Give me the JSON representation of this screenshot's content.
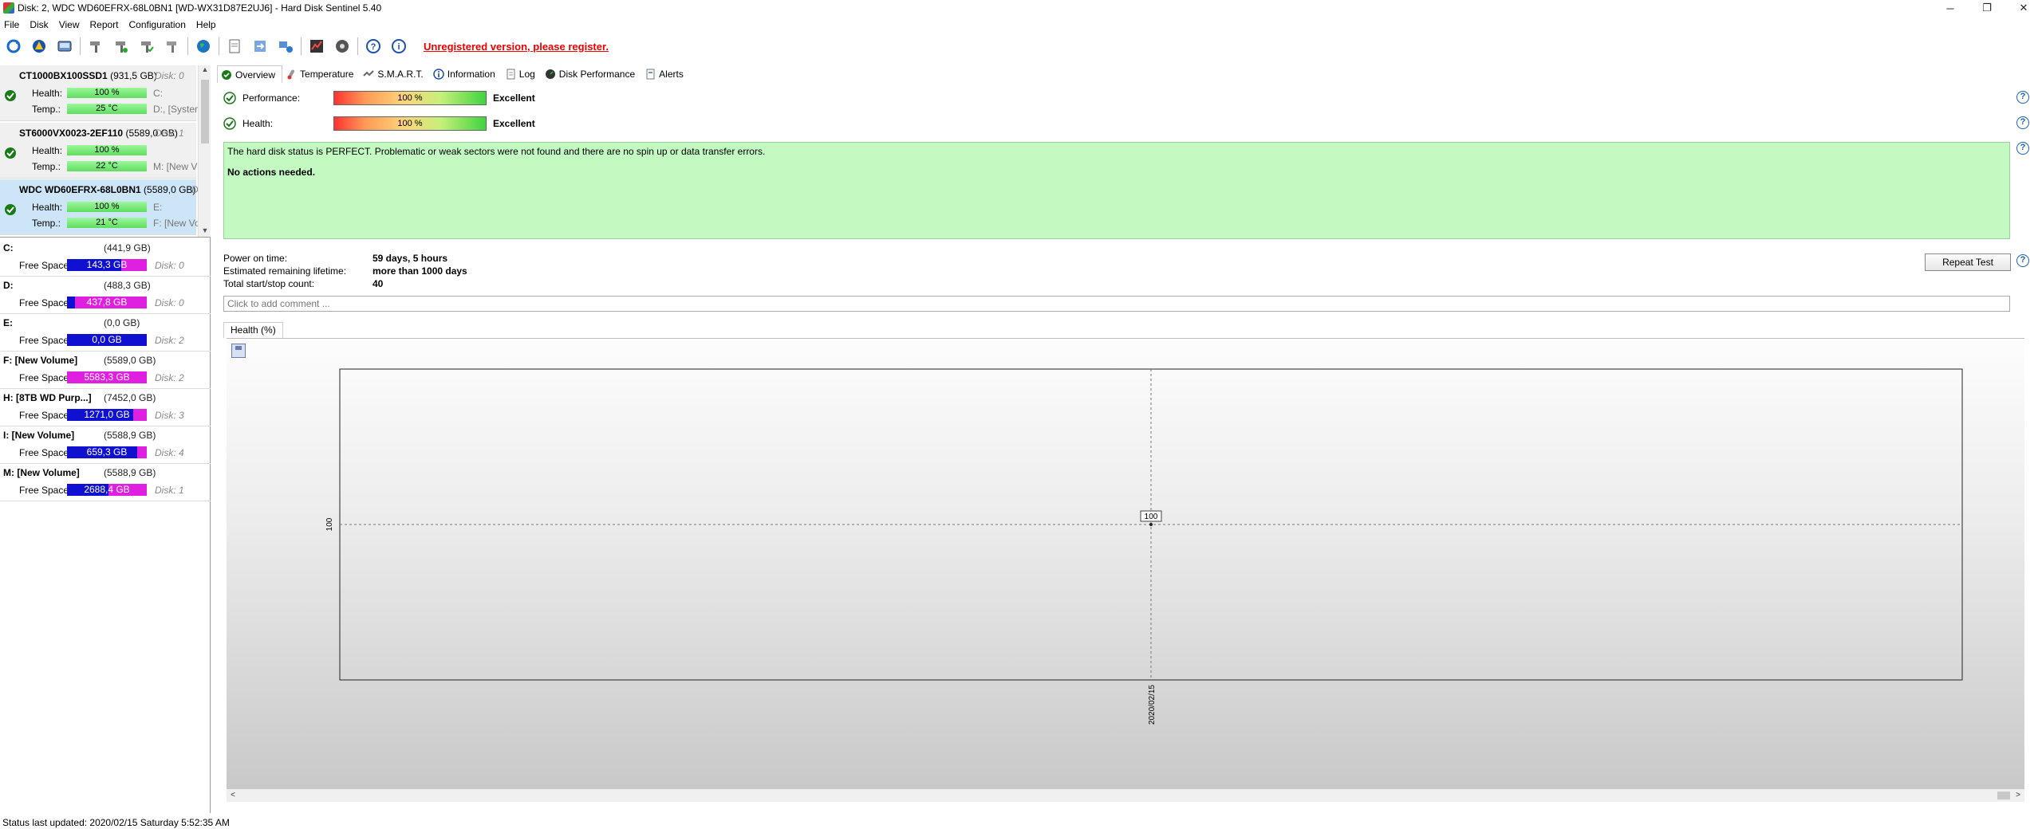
{
  "window": {
    "title": "Disk: 2, WDC WD60EFRX-68L0BN1 [WD-WX31D87E2UJ6]  -  Hard Disk Sentinel 5.40",
    "controls": [
      "─",
      "❐",
      "✕"
    ]
  },
  "menu": [
    "File",
    "Disk",
    "View",
    "Report",
    "Configuration",
    "Help"
  ],
  "toolbar": {
    "register_link": "Unregistered version, please register."
  },
  "disks": [
    {
      "name": "CT1000BX100SSD1",
      "size": "(931,5 GB)",
      "disk": "Disk: 0",
      "health_label": "Health:",
      "health": "100 %",
      "temp_label": "Temp.:",
      "temp": "25 °C",
      "vol1": "C:",
      "vol2": "D:, [Syster"
    },
    {
      "name": "ST6000VX0023-2EF110",
      "size": "(5589,0 GB)",
      "disk": "Disk: 1",
      "health_label": "Health:",
      "health": "100 %",
      "temp_label": "Temp.:",
      "temp": "22 °C",
      "vol1": "",
      "vol2": "M: [New V"
    },
    {
      "name": "WDC WD60EFRX-68L0BN1",
      "size": "(5589,0 GB)",
      "disk": "D",
      "health_label": "Health:",
      "health": "100 %",
      "temp_label": "Temp.:",
      "temp": "21 °C",
      "vol1": "E:",
      "vol2": "F: [New Vo"
    }
  ],
  "volumes": [
    {
      "name": "C:",
      "size": "(441,9 GB)",
      "label": "Free Space",
      "free": "143,3 GB",
      "free_fraction": 0.324,
      "disk": "Disk: 0"
    },
    {
      "name": "D:",
      "size": "(488,3 GB)",
      "label": "Free Space",
      "free": "437,8 GB",
      "free_fraction": 0.897,
      "disk": "Disk: 0"
    },
    {
      "name": "E:",
      "size": "(0,0 GB)",
      "label": "Free Space",
      "free": "0,0 GB",
      "free_fraction": 0.0,
      "disk": "Disk: 2"
    },
    {
      "name": "F: [New Volume]",
      "size": "(5589,0 GB)",
      "label": "Free Space",
      "free": "5583,3 GB",
      "free_fraction": 0.999,
      "disk": "Disk: 2"
    },
    {
      "name": "H: [8TB WD Purp...]",
      "size": "(7452,0 GB)",
      "label": "Free Space",
      "free": "1271,0 GB",
      "free_fraction": 0.171,
      "disk": "Disk: 3"
    },
    {
      "name": "I: [New Volume]",
      "size": "(5588,9 GB)",
      "label": "Free Space",
      "free": "659,3 GB",
      "free_fraction": 0.118,
      "disk": "Disk: 4"
    },
    {
      "name": "M: [New Volume]",
      "size": "(5588,9 GB)",
      "label": "Free Space",
      "free": "2688,4 GB",
      "free_fraction": 0.481,
      "disk": "Disk: 1"
    }
  ],
  "tabs": [
    "Overview",
    "Temperature",
    "S.M.A.R.T.",
    "Information",
    "Log",
    "Disk Performance",
    "Alerts"
  ],
  "overview": {
    "performance_label": "Performance:",
    "performance_value": "100 %",
    "performance_text": "Excellent",
    "health_label": "Health:",
    "health_value": "100 %",
    "health_text": "Excellent",
    "status_line1": "The hard disk status is PERFECT. Problematic or weak sectors were not found and there are no spin up or data transfer errors.",
    "status_line2": "No actions needed.",
    "power_on_label": "Power on time:",
    "power_on_value": "59 days, 5 hours",
    "lifetime_label": "Estimated remaining lifetime:",
    "lifetime_value": "more than 1000 days",
    "startstop_label": "Total start/stop count:",
    "startstop_value": "40",
    "repeat_test": "Repeat Test",
    "comment_placeholder": "Click to add comment ...",
    "chart_tab": "Health (%)"
  },
  "chart_data": {
    "type": "line",
    "x": [
      "2020/02/15"
    ],
    "series": [
      {
        "values": [
          100
        ]
      }
    ],
    "ytick": "100",
    "point_label": "100",
    "grid": true
  },
  "statusbar": "Status last updated: 2020/02/15 Saturday 5:52:35 AM"
}
